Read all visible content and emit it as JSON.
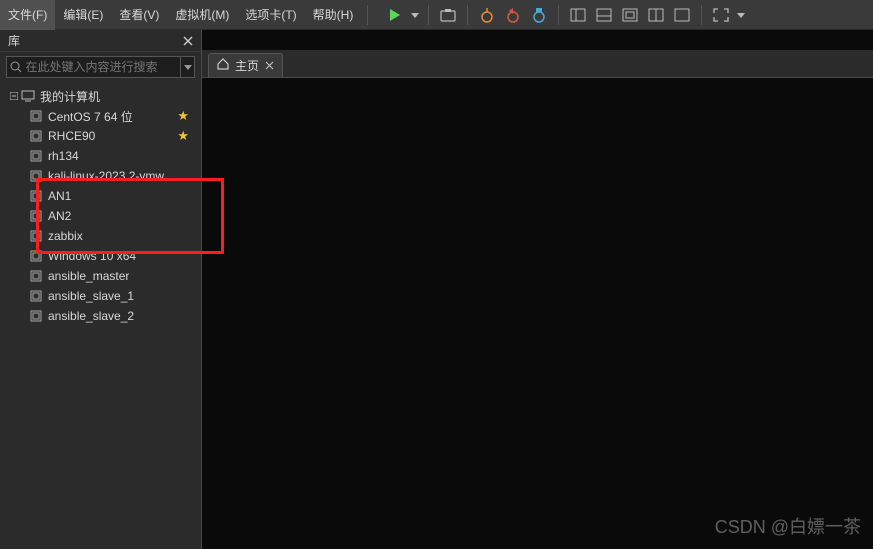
{
  "menu": {
    "file": "文件(F)",
    "edit": "编辑(E)",
    "view": "查看(V)",
    "vm": "虚拟机(M)",
    "tabs": "选项卡(T)",
    "help": "帮助(H)"
  },
  "toolbar": {
    "play": "play-icon",
    "dropdown": "dropdown-icon"
  },
  "sidebar": {
    "title": "库",
    "search_placeholder": "在此处键入内容进行搜索",
    "root": "我的计算机",
    "items": [
      {
        "label": "CentOS 7 64 位",
        "star": true
      },
      {
        "label": "RHCE90",
        "star": true
      },
      {
        "label": "rh134",
        "star": false
      },
      {
        "label": "kali-linux-2023.2-vmw",
        "star": false
      },
      {
        "label": "AN1",
        "star": false
      },
      {
        "label": "AN2",
        "star": false
      },
      {
        "label": "zabbix",
        "star": false
      },
      {
        "label": "Windows 10 x64",
        "star": false
      },
      {
        "label": "ansible_master",
        "star": false
      },
      {
        "label": "ansible_slave_1",
        "star": false
      },
      {
        "label": "ansible_slave_2",
        "star": false
      }
    ]
  },
  "tabs": {
    "home": "主页"
  },
  "watermark": "CSDN @白嫖一茶"
}
